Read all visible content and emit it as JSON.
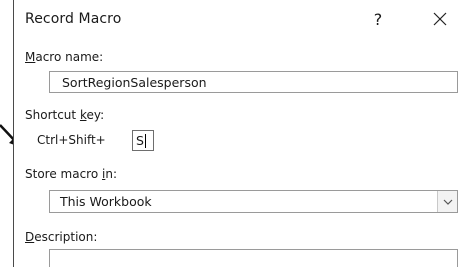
{
  "dialog": {
    "title": "Record Macro",
    "help_label": "?",
    "close_icon": "close-icon"
  },
  "macro_name": {
    "label_mnemonic": "M",
    "label_rest": "acro name:",
    "value": "SortRegionSalesperson"
  },
  "shortcut": {
    "label_prefix": "Shortcut ",
    "label_mnemonic": "k",
    "label_suffix": "ey:",
    "prefix_text": "Ctrl+Shift+",
    "value": "S"
  },
  "store_in": {
    "label_prefix": "Store macro ",
    "label_mnemonic": "i",
    "label_suffix": "n:",
    "selected": "This Workbook",
    "dropdown_icon": "chevron-down-icon"
  },
  "description": {
    "label_mnemonic": "D",
    "label_rest": "escription:",
    "value": ""
  },
  "annotation": {
    "pointer_icon": "arrow-pointer-icon"
  }
}
